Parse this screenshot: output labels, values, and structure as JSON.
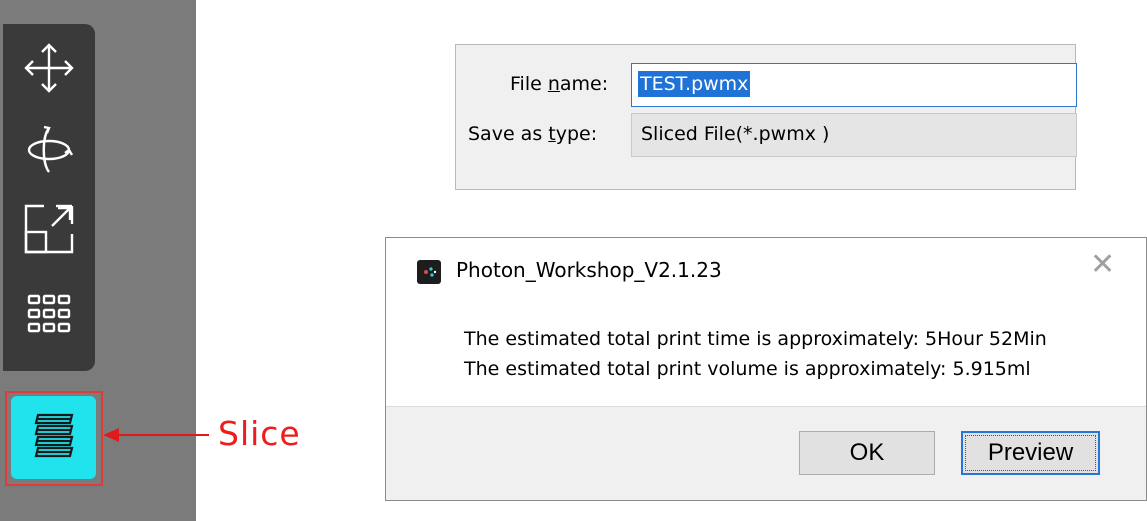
{
  "annotation": {
    "label": "Slice"
  },
  "toolbar": {
    "tools": [
      {
        "icon": "move-icon"
      },
      {
        "icon": "rotate-icon"
      },
      {
        "icon": "scale-icon"
      },
      {
        "icon": "grid-icon"
      }
    ],
    "slice_icon": "layers-icon",
    "accent": "#20e3ee",
    "highlight": "#e03b3b"
  },
  "save_dialog": {
    "filename_label_pre": "File ",
    "filename_label_u": "n",
    "filename_label_post": "ame:",
    "filename_value": "TEST.pwmx",
    "type_label_pre": "Save as ",
    "type_label_u": "t",
    "type_label_post": "ype:",
    "type_value": "Sliced File(*.pwmx )"
  },
  "message_dialog": {
    "title": "Photon_Workshop_V2.1.23",
    "close": "✕",
    "line1": "The estimated total print time is approximately: 5Hour 52Min",
    "line2": "The estimated total print volume is approximately: 5.915ml",
    "ok_label": "OK",
    "preview_label": "Preview"
  }
}
